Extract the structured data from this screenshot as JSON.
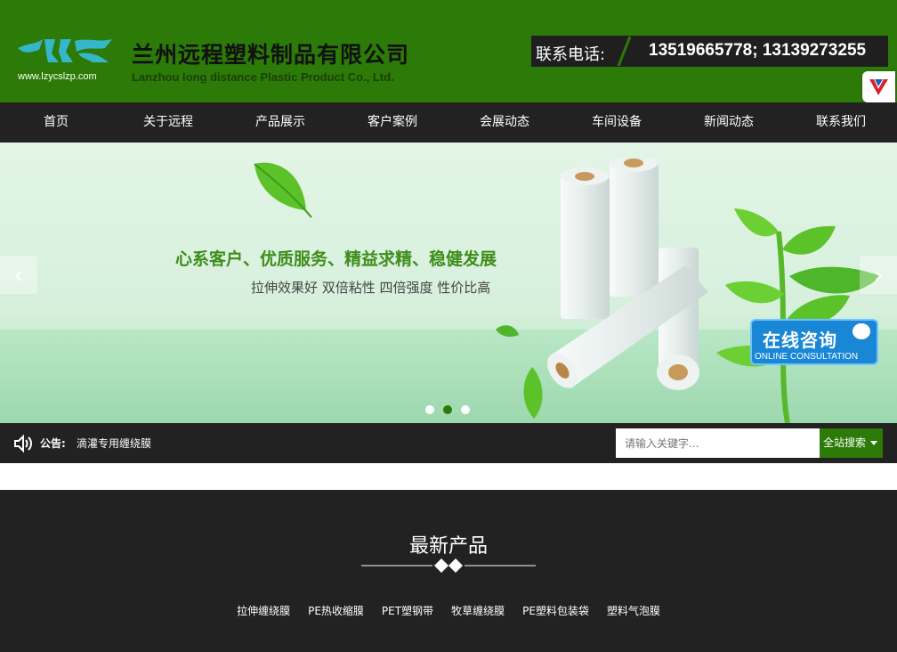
{
  "header": {
    "logo_url_text": "www.lzycslzp.com",
    "company_cn": "兰州远程塑料制品有限公司",
    "company_en": "Lanzhou long distance Plastic Product Co., Ltd.",
    "phone_label": "联系电话:",
    "phone_numbers": "13519665778; 13139273255"
  },
  "nav": {
    "items": [
      "首页",
      "关于远程",
      "产品展示",
      "客户案例",
      "会展动态",
      "车间设备",
      "新闻动态",
      "联系我们"
    ]
  },
  "banner": {
    "slogan": "心系客户、优质服务、精益求精、稳健发展",
    "sub_slogan": "拉伸效果好 双倍粘性 四倍强度 性价比高",
    "prev_arrow": "‹",
    "next_arrow": "›",
    "slide_count": 3,
    "active_slide": 2,
    "consult_cn": "在线咨询",
    "consult_en": "ONLINE CONSULTATION"
  },
  "notice": {
    "label": "公告:",
    "text": "滴灌专用缠绕膜",
    "search_placeholder": "请输入关键字...",
    "search_button": "全站搜索"
  },
  "products": {
    "title": "最新产品",
    "categories": [
      "拉伸缠绕膜",
      "PE热收缩膜",
      "PET塑钢带",
      "牧草缠绕膜",
      "PE塑料包装袋",
      "塑料气泡膜"
    ]
  },
  "colors": {
    "brand_green": "#2c7a07",
    "dark_bar": "#222222",
    "consult_blue": "#1a86d6"
  }
}
